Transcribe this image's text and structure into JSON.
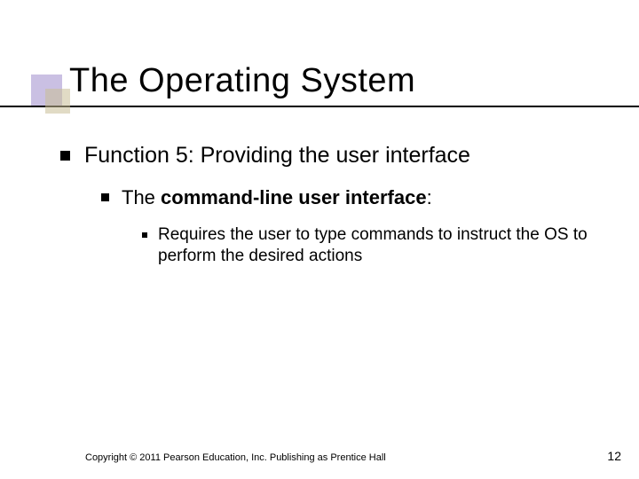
{
  "title": "The Operating System",
  "bullets": {
    "lvl1": "Function 5: Providing the user interface",
    "lvl2_prefix": "The ",
    "lvl2_bold": "command-line user interface",
    "lvl2_suffix": ":",
    "lvl3": "Requires the user to type commands to instruct the OS to perform the desired actions"
  },
  "footer": {
    "copyright": "Copyright © 2011 Pearson Education, Inc. Publishing as Prentice Hall",
    "page": "12"
  }
}
